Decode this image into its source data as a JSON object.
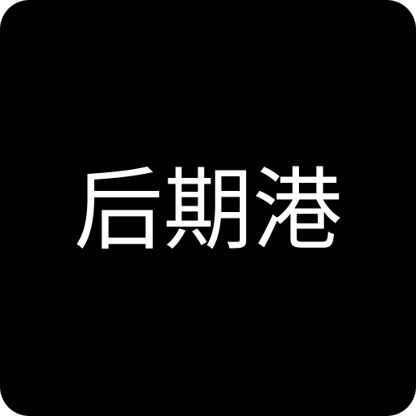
{
  "icon": {
    "label": "后期港",
    "background_color": "#000000",
    "text_color": "#ffffff"
  }
}
